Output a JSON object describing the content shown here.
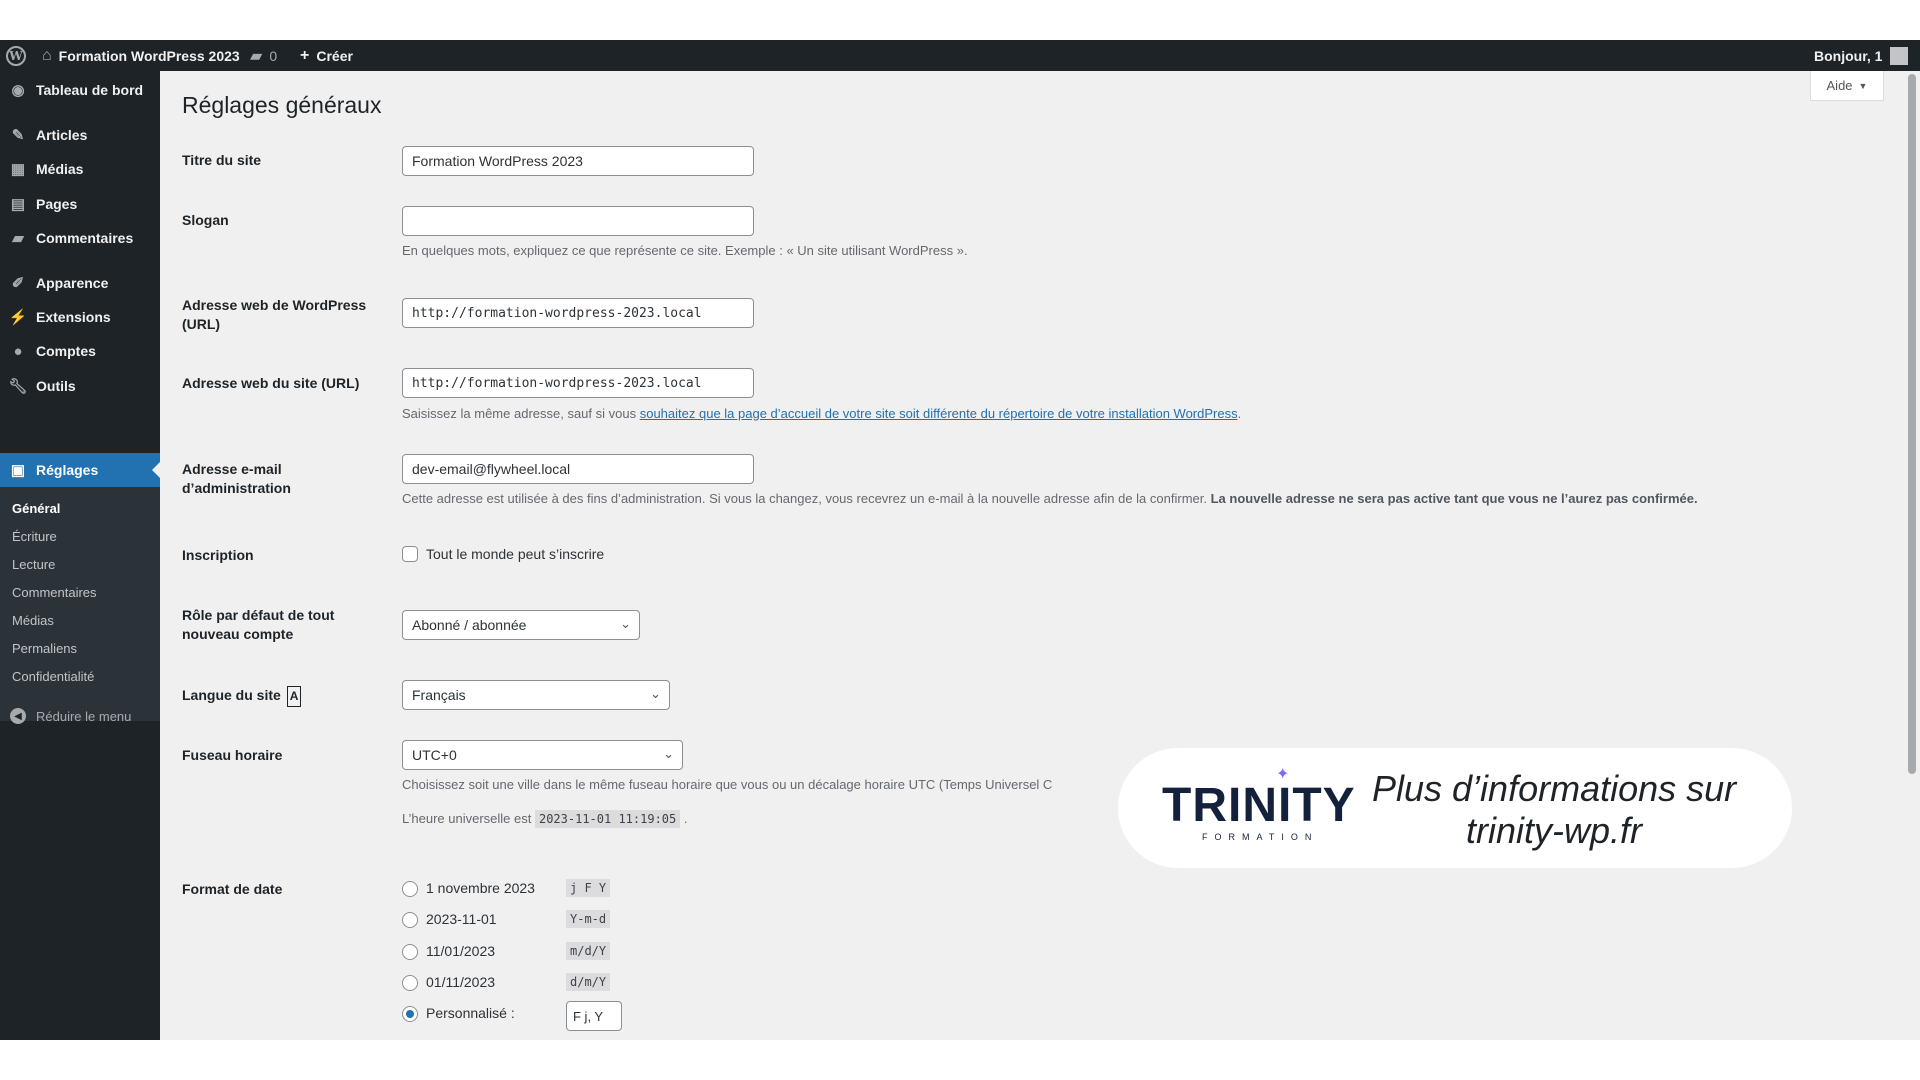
{
  "admin_bar": {
    "site_name": "Formation WordPress 2023",
    "comments_count": "0",
    "new_label": "Créer",
    "greeting": "Bonjour, 1"
  },
  "sidebar": {
    "dashboard": "Tableau de bord",
    "items": [
      "Articles",
      "Médias",
      "Pages",
      "Commentaires",
      "Apparence",
      "Extensions",
      "Comptes",
      "Outils",
      "Réglages"
    ],
    "submenu": [
      "Général",
      "Écriture",
      "Lecture",
      "Commentaires",
      "Médias",
      "Permaliens",
      "Confidentialité"
    ],
    "collapse": "Réduire le menu"
  },
  "help_button": "Aide",
  "page_title": "Réglages généraux",
  "form": {
    "site_title": {
      "label": "Titre du site",
      "value": "Formation WordPress 2023"
    },
    "tagline": {
      "label": "Slogan",
      "value": "",
      "description": "En quelques mots, expliquez ce que représente ce site. Exemple : « Un site utilisant WordPress »."
    },
    "wp_url": {
      "label": "Adresse web de WordPress (URL)",
      "value": "http://formation-wordpress-2023.local"
    },
    "site_url": {
      "label": "Adresse web du site (URL)",
      "value": "http://formation-wordpress-2023.local",
      "description_before": "Saisissez la même adresse, sauf si vous ",
      "description_link": "souhaitez que la page d’accueil de votre site soit différente du répertoire de votre installation WordPress",
      "description_after": "."
    },
    "admin_email": {
      "label": "Adresse e-mail d’administration",
      "value": "dev-email@flywheel.local",
      "description": "Cette adresse est utilisée à des fins d’administration. Si vous la changez, vous recevrez un e-mail à la nouvelle adresse afin de la confirmer.",
      "description_bold": "La nouvelle adresse ne sera pas active tant que vous ne l’aurez pas confirmée."
    },
    "membership": {
      "label": "Inscription",
      "checkbox_label": "Tout le monde peut s’inscrire",
      "checked": false
    },
    "default_role": {
      "label": "Rôle par défaut de tout nouveau compte",
      "value": "Abonné / abonnée"
    },
    "site_language": {
      "label": "Langue du site",
      "value": "Français"
    },
    "timezone": {
      "label": "Fuseau horaire",
      "value": "UTC+0",
      "description": "Choisissez soit une ville dans le même fuseau horaire que vous ou un décalage horaire UTC (Temps Universel C",
      "utc_prefix": "L’heure universelle est",
      "utc_time": "2023-11-01 11:19:05",
      "utc_suffix": "."
    },
    "date_format": {
      "label": "Format de date",
      "options": [
        {
          "label": "1 novembre 2023",
          "code": "j F Y",
          "checked": false
        },
        {
          "label": "2023-11-01",
          "code": "Y-m-d",
          "checked": false
        },
        {
          "label": "11/01/2023",
          "code": "m/d/Y",
          "checked": false
        },
        {
          "label": "01/11/2023",
          "code": "d/m/Y",
          "checked": false
        },
        {
          "label": "Personnalisé :",
          "code": "F j, Y",
          "checked": true
        }
      ]
    }
  },
  "promo": {
    "logo": "TRINITY",
    "logo_sub": "FORMATION",
    "line1": "Plus d’informations sur",
    "line2": "trinity-wp.fr"
  }
}
